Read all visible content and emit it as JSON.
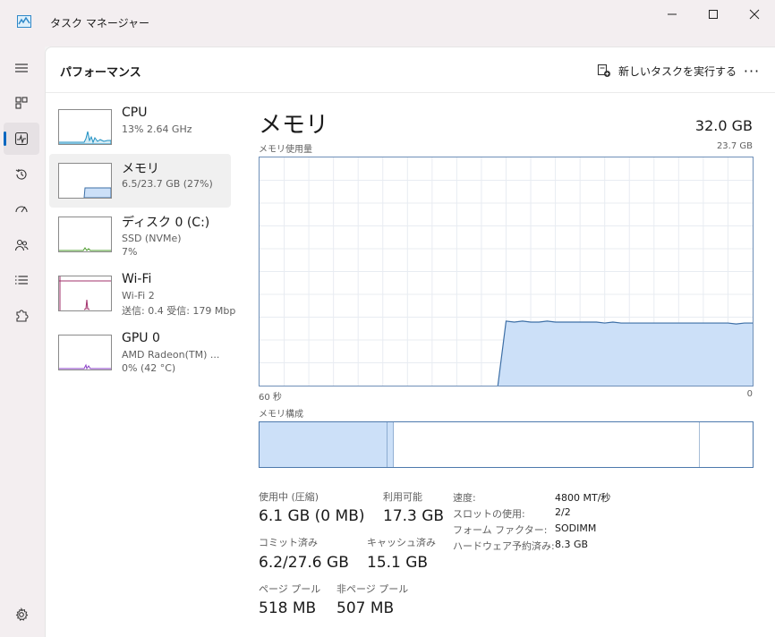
{
  "window": {
    "title": "タスク マネージャー",
    "controls": {
      "minimize": "—",
      "maximize": "☐",
      "close": "✕"
    }
  },
  "rail": {
    "items": [
      {
        "name": "menu",
        "icon": "hamburger-icon"
      },
      {
        "name": "processes",
        "icon": "grid-icon"
      },
      {
        "name": "performance",
        "icon": "pulse-icon",
        "active": true
      },
      {
        "name": "app-history",
        "icon": "history-icon"
      },
      {
        "name": "startup-apps",
        "icon": "speedometer-icon"
      },
      {
        "name": "users",
        "icon": "users-icon"
      },
      {
        "name": "details",
        "icon": "list-icon"
      },
      {
        "name": "services",
        "icon": "puzzle-icon"
      },
      {
        "name": "settings",
        "icon": "gear-icon"
      }
    ]
  },
  "header": {
    "title": "パフォーマンス",
    "run_task_label": "新しいタスクを実行する",
    "more_label": "···"
  },
  "devices": [
    {
      "name": "CPU",
      "line1": "13%  2.64 GHz",
      "line2": ""
    },
    {
      "name": "メモリ",
      "line1": "6.5/23.7 GB (27%)",
      "line2": "",
      "selected": true
    },
    {
      "name": "ディスク 0 (C:)",
      "line1": "SSD (NVMe)",
      "line2": "7%"
    },
    {
      "name": "Wi-Fi",
      "line1": "Wi-Fi 2",
      "line2": "送信: 0.4  受信: 179 Mbp"
    },
    {
      "name": "GPU 0",
      "line1": "AMD Radeon(TM) ...",
      "line2": "0%  (42 °C)"
    }
  ],
  "detail": {
    "title": "メモリ",
    "total": "32.0 GB",
    "usage_label": "メモリ使用量",
    "usage_max": "23.7 GB",
    "time_left": "60 秒",
    "time_right": "0",
    "composition_label": "メモリ構成"
  },
  "stats": {
    "in_use_label": "使用中 (圧縮)",
    "in_use_value": "6.1 GB (0 MB)",
    "available_label": "利用可能",
    "available_value": "17.3 GB",
    "committed_label": "コミット済み",
    "committed_value": "6.2/27.6 GB",
    "cached_label": "キャッシュ済み",
    "cached_value": "15.1 GB",
    "paged_label": "ページ プール",
    "paged_value": "518 MB",
    "nonpaged_label": "非ページ プール",
    "nonpaged_value": "507 MB"
  },
  "specs": [
    {
      "key": "速度:",
      "value": "4800 MT/秒"
    },
    {
      "key": "スロットの使用:",
      "value": "2/2"
    },
    {
      "key": "フォーム ファクター:",
      "value": "SODIMM"
    },
    {
      "key": "ハードウェア予約済み:",
      "value": "8.3 GB"
    }
  ],
  "chart_data": {
    "type": "area",
    "title": "メモリ使用量",
    "xlabel": "",
    "ylabel": "",
    "x_range": [
      "60 秒",
      "0"
    ],
    "ylim": [
      0,
      23.7
    ],
    "y_unit": "GB",
    "grid": true,
    "series": [
      {
        "values": [
          null,
          null,
          null,
          null,
          null,
          null,
          null,
          null,
          null,
          null,
          null,
          null,
          null,
          null,
          null,
          null,
          null,
          null,
          null,
          null,
          null,
          null,
          null,
          null,
          null,
          null,
          null,
          null,
          null,
          0,
          6.7,
          6.6,
          6.7,
          6.6,
          6.6,
          6.7,
          6.6,
          6.6,
          6.6,
          6.6,
          6.6,
          6.6,
          6.5,
          6.6,
          6.5,
          6.5,
          6.5,
          6.5,
          6.5,
          6.5,
          6.5,
          6.5,
          6.5,
          6.5,
          6.5,
          6.5,
          6.5,
          6.5,
          6.4,
          6.5,
          6.5
        ]
      }
    ],
    "colors": {
      "fill": "#cce0f8",
      "line": "#3d6fa6",
      "grid": "#e8ecf2"
    }
  },
  "composition": {
    "segments": [
      {
        "name": "in-use",
        "fraction": 0.259
      },
      {
        "name": "modified",
        "fraction": 0.013
      },
      {
        "name": "standby",
        "fraction": 0.62
      },
      {
        "name": "free",
        "fraction": 0.108
      }
    ]
  }
}
